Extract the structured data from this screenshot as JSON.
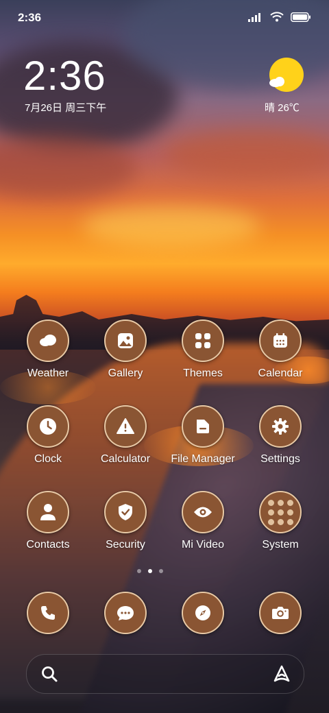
{
  "status_bar": {
    "time": "2:36"
  },
  "lockclock": {
    "time": "2:36",
    "date": "7月26日 周三下午"
  },
  "weather": {
    "text": "晴 26℃"
  },
  "apps": [
    {
      "label": "Weather",
      "icon": "cloud-icon"
    },
    {
      "label": "Gallery",
      "icon": "image-icon"
    },
    {
      "label": "Themes",
      "icon": "grid-icon"
    },
    {
      "label": "Calendar",
      "icon": "calendar-icon"
    },
    {
      "label": "Clock",
      "icon": "clock-icon"
    },
    {
      "label": "Calculator",
      "icon": "warning-icon"
    },
    {
      "label": "File Manager",
      "icon": "folder-icon"
    },
    {
      "label": "Settings",
      "icon": "gear-icon"
    },
    {
      "label": "Contacts",
      "icon": "person-icon"
    },
    {
      "label": "Security",
      "icon": "shield-icon"
    },
    {
      "label": "Mi Video",
      "icon": "eye-icon"
    },
    {
      "label": "System",
      "icon": "folder-grid-icon"
    }
  ],
  "dock": [
    {
      "icon": "phone-icon"
    },
    {
      "icon": "message-icon"
    },
    {
      "icon": "compass-icon"
    },
    {
      "icon": "camera-icon"
    }
  ],
  "page_indicator": {
    "total": 3,
    "active": 1
  },
  "colors": {
    "icon_fill": "#8a5533",
    "icon_ring": "#e8c9a6",
    "glyph": "#ffffff",
    "sun": "#ffd21a"
  }
}
